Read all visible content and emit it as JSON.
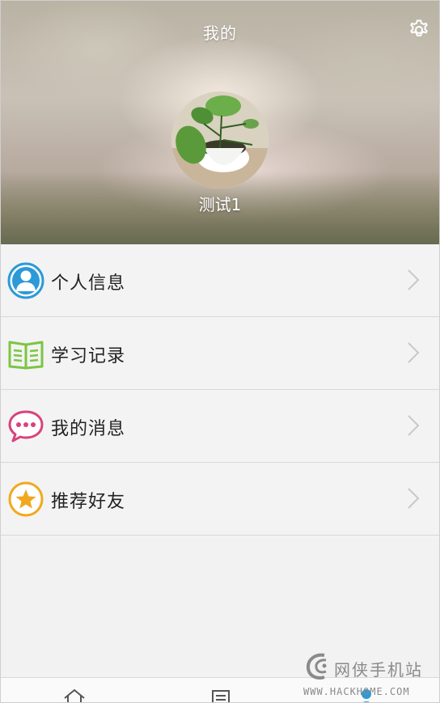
{
  "header": {
    "title": "我的",
    "username": "测试1"
  },
  "icons": {
    "settings": "gear-icon",
    "tabs": [
      "home-icon",
      "document-icon",
      "person-icon"
    ]
  },
  "menu": {
    "items": [
      {
        "label": "个人信息",
        "icon": "user-profile-icon",
        "color": "#2b9ad7"
      },
      {
        "label": "学习记录",
        "icon": "open-book-icon",
        "color": "#7cc542"
      },
      {
        "label": "我的消息",
        "icon": "chat-bubble-icon",
        "color": "#d9427c"
      },
      {
        "label": "推荐好友",
        "icon": "star-circle-icon",
        "color": "#f0a91e"
      }
    ]
  },
  "watermark": {
    "name": "网侠手机站",
    "url": "WWW.HACKHOME.COM"
  }
}
